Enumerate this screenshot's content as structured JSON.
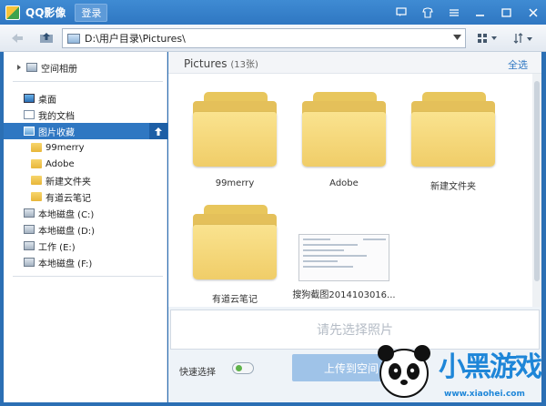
{
  "window": {
    "title": "QQ影像",
    "login_label": "登录"
  },
  "toolbar": {
    "address_path": "D:\\用户目录\\Pictures\\"
  },
  "sidebar": {
    "cloud_album": "空间相册",
    "items": [
      {
        "label": "桌面",
        "icon": "desktop-icon"
      },
      {
        "label": "我的文档",
        "icon": "document-icon"
      },
      {
        "label": "图片收藏",
        "icon": "picture-icon",
        "active": true
      },
      {
        "label": "99merry",
        "icon": "folder-icon"
      },
      {
        "label": "Adobe",
        "icon": "folder-icon"
      },
      {
        "label": "新建文件夹",
        "icon": "folder-icon"
      },
      {
        "label": "有道云笔记",
        "icon": "folder-icon"
      },
      {
        "label": "本地磁盘 (C:)",
        "icon": "drive-icon"
      },
      {
        "label": "本地磁盘 (D:)",
        "icon": "drive-icon"
      },
      {
        "label": "工作 (E:)",
        "icon": "drive-icon"
      },
      {
        "label": "本地磁盘 (F:)",
        "icon": "drive-icon"
      }
    ]
  },
  "main": {
    "title": "Pictures",
    "count": "(13张)",
    "select_all": "全选",
    "thumbnails": [
      {
        "label": "99merry",
        "type": "folder"
      },
      {
        "label": "Adobe",
        "type": "folder"
      },
      {
        "label": "新建文件夹",
        "type": "folder"
      },
      {
        "label": "有道云笔记",
        "type": "folder"
      },
      {
        "label": "搜狗截图2014103016...",
        "type": "image"
      }
    ]
  },
  "upload": {
    "hint": "请先选择照片",
    "quick_select_label": "快速选择",
    "upload_button": "上传到空间",
    "quick_select_on": true
  },
  "watermark": {
    "brand": "小黑游戏",
    "url": "www.xiaohei.com"
  },
  "colors": {
    "title_bar": "#2f77c2",
    "accent": "#2f77c2",
    "folder": "#f0cd68"
  }
}
